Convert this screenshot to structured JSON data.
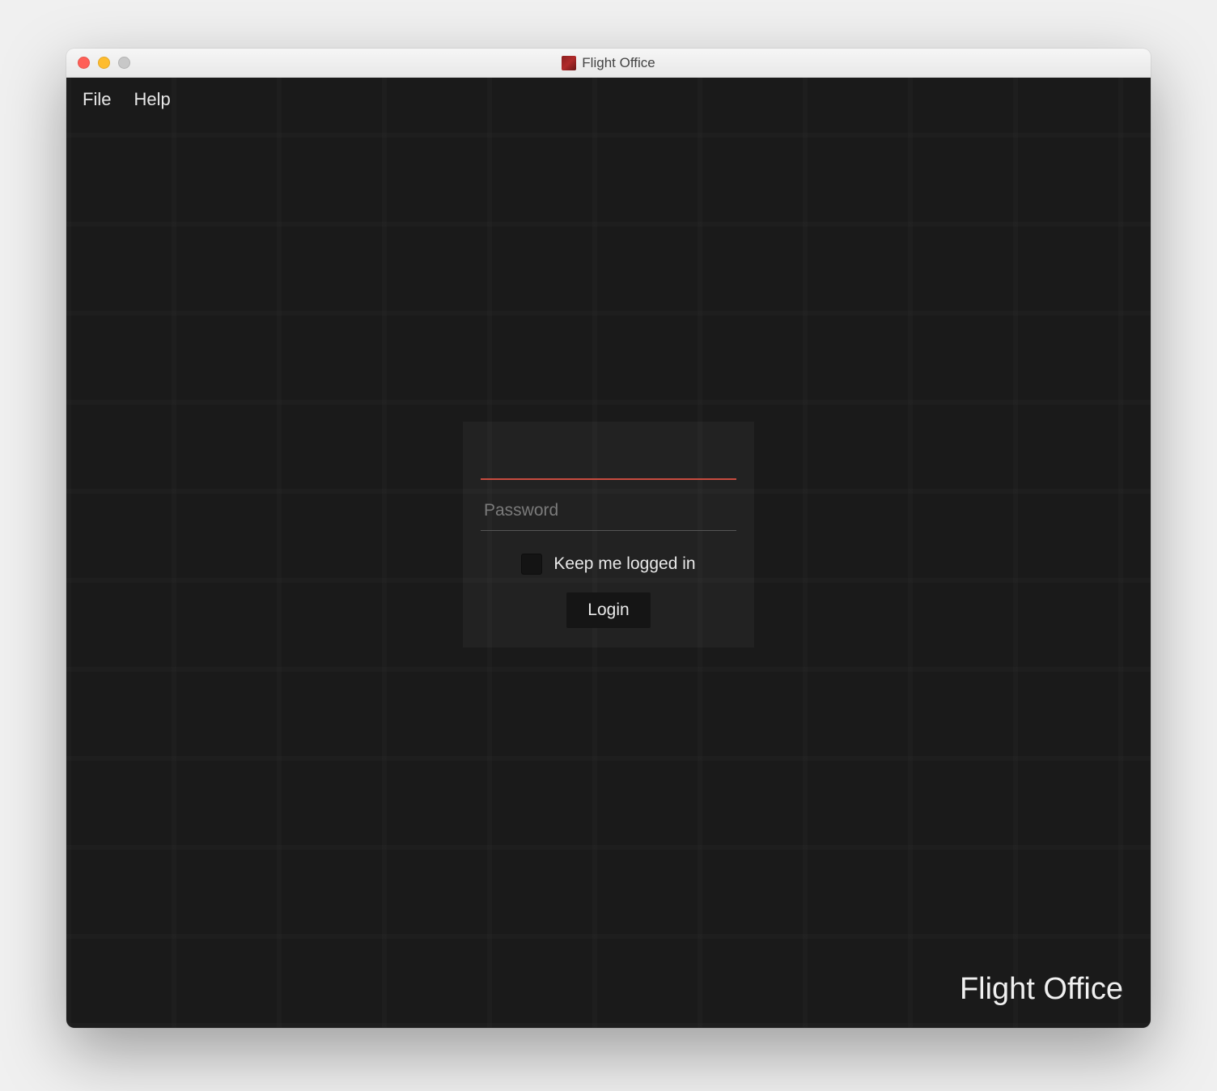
{
  "window": {
    "title": "Flight Office"
  },
  "menu": {
    "file": "File",
    "help": "Help"
  },
  "login": {
    "username_value": "",
    "password_placeholder": "Password",
    "keep_logged_in_label": "Keep me logged in",
    "login_button_label": "Login"
  },
  "brand": {
    "text": "Flight Office"
  },
  "colors": {
    "accent": "#c84c3f",
    "background": "#1a1a1a"
  }
}
